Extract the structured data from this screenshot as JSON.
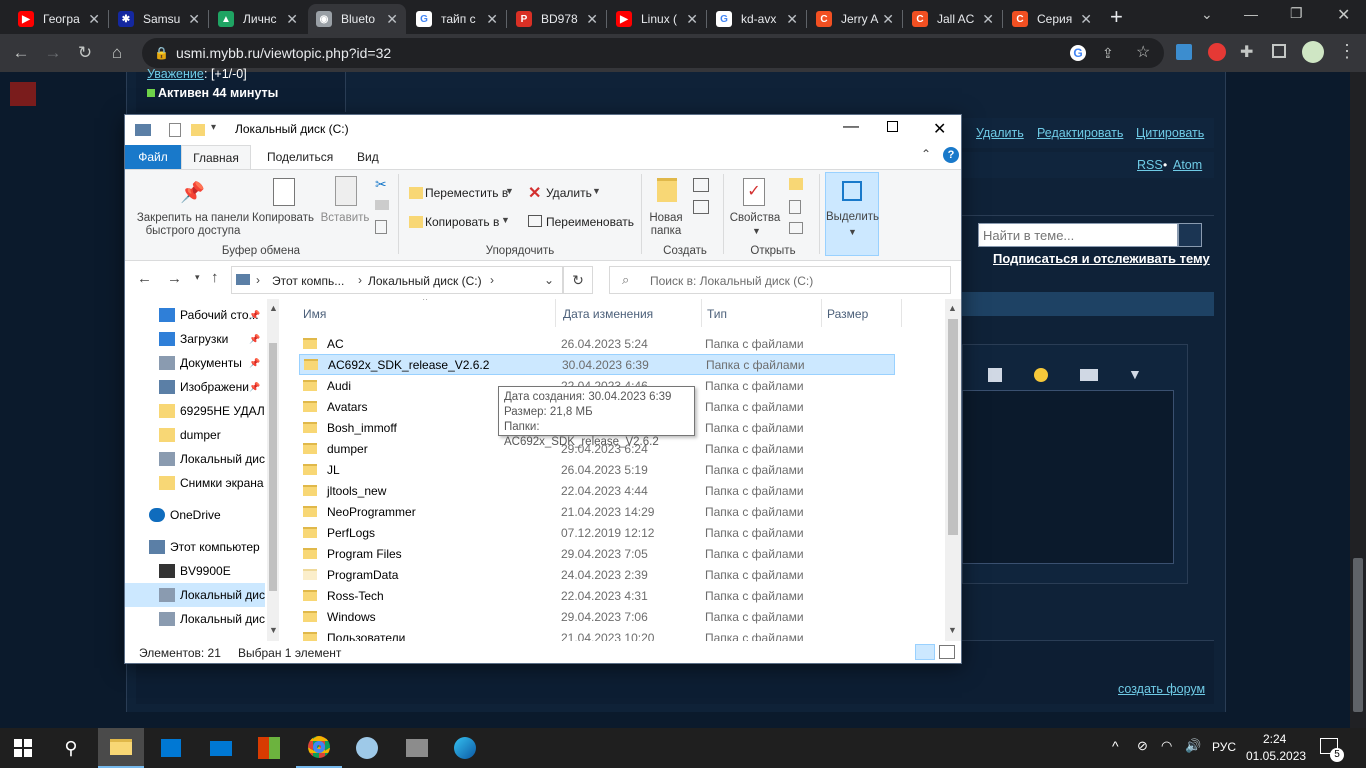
{
  "browser": {
    "tabs": [
      {
        "label": "Геогра",
        "color": "#ff0000",
        "glyph": "▶"
      },
      {
        "label": "Samsu",
        "color": "#1428a0",
        "glyph": "✱"
      },
      {
        "label": "Личнс",
        "color": "#1fa463",
        "glyph": "▲"
      },
      {
        "label": "Blueto",
        "color": "#9aa0a6",
        "glyph": "◉",
        "active": true
      },
      {
        "label": "тайп с",
        "color": "#ffffff",
        "glyph": "G"
      },
      {
        "label": "BD978",
        "color": "#d93025",
        "glyph": "P"
      },
      {
        "label": "Linux (",
        "color": "#ff0000",
        "glyph": "▶"
      },
      {
        "label": "kd-avx",
        "color": "#ffffff",
        "glyph": "G"
      },
      {
        "label": "Jerry A",
        "color": "#f25022",
        "glyph": "C"
      },
      {
        "label": "Jall AC",
        "color": "#f25022",
        "glyph": "C"
      },
      {
        "label": "Серия",
        "color": "#f25022",
        "glyph": "C"
      }
    ],
    "url": "usmi.mybb.ru/viewtopic.php?id=32"
  },
  "forum": {
    "respect": "Уважение",
    "respect_value": ": [+1/-0]",
    "active": "Активен 44 минуты",
    "delete": "Удалить",
    "edit": "Редактировать",
    "quote": "Цитировать",
    "rss": "RSS",
    "bullet": "•",
    "atom": "Atom",
    "search_placeholder": "Найти в теме...",
    "subscribe": "Подписаться и отслеживать тему",
    "create_forum": "создать форум"
  },
  "explorer": {
    "title": "Локальный диск (C:)",
    "ribbon_tabs": [
      "Файл",
      "Главная",
      "Поделиться",
      "Вид"
    ],
    "ribbon": {
      "pin": "Закрепить на панели быстрого доступа",
      "copy": "Копировать",
      "paste": "Вставить",
      "clipboard_group": "Буфер обмена",
      "move_to": "Переместить в",
      "copy_to": "Копировать в",
      "delete": "Удалить",
      "rename": "Переименовать",
      "organize_group": "Упорядочить",
      "new_folder": "Новая папка",
      "create_group": "Создать",
      "properties": "Свойства",
      "open_group": "Открыть",
      "select": "Выделить"
    },
    "breadcrumb": [
      "Этот компь...",
      "Локальный диск (C:)"
    ],
    "search_placeholder": "Поиск в: Локальный диск (C:)",
    "nav": [
      {
        "label": "Рабочий сто...",
        "icon": "desktop"
      },
      {
        "label": "Загрузки",
        "icon": "download"
      },
      {
        "label": "Документы",
        "icon": "documents"
      },
      {
        "label": "Изображени",
        "icon": "pictures"
      },
      {
        "label": "69295НЕ УДАЛЯ",
        "icon": "folder"
      },
      {
        "label": "dumper",
        "icon": "folder"
      },
      {
        "label": "Локальный дис",
        "icon": "drive"
      },
      {
        "label": "Снимки экрана",
        "icon": "folder"
      },
      {
        "label": "OneDrive",
        "icon": "cloud"
      },
      {
        "label": "Этот компьютер",
        "icon": "computer"
      },
      {
        "label": "BV9900E",
        "icon": "phone"
      },
      {
        "label": "Локальный дис",
        "icon": "drive",
        "selected": true
      },
      {
        "label": "Локальный дис",
        "icon": "drive"
      }
    ],
    "columns": [
      "Имя",
      "Дата изменения",
      "Тип",
      "Размер"
    ],
    "files": [
      {
        "name": "AC",
        "date": "26.04.2023 5:24",
        "type": "Папка с файлами"
      },
      {
        "name": "AC692x_SDK_release_V2.6.2",
        "date": "30.04.2023 6:39",
        "type": "Папка с файлами",
        "selected": true
      },
      {
        "name": "Audi",
        "date": "22.04.2023 4:46",
        "type": "Папка с файлами"
      },
      {
        "name": "Avatars",
        "date": "",
        "type": "Папка с файлами"
      },
      {
        "name": "Bosh_immoff",
        "date": "",
        "type": "Папка с файлами"
      },
      {
        "name": "dumper",
        "date": "29.04.2023 6:24",
        "type": "Папка с файлами"
      },
      {
        "name": "JL",
        "date": "26.04.2023 5:19",
        "type": "Папка с файлами"
      },
      {
        "name": "jltools_new",
        "date": "22.04.2023 4:44",
        "type": "Папка с файлами"
      },
      {
        "name": "NeoProgrammer",
        "date": "21.04.2023 14:29",
        "type": "Папка с файлами"
      },
      {
        "name": "PerfLogs",
        "date": "07.12.2019 12:12",
        "type": "Папка с файлами"
      },
      {
        "name": "Program Files",
        "date": "29.04.2023 7:05",
        "type": "Папка с файлами"
      },
      {
        "name": "ProgramData",
        "date": "24.04.2023 2:39",
        "type": "Папка с файлами"
      },
      {
        "name": "Ross-Tech",
        "date": "22.04.2023 4:31",
        "type": "Папка с файлами"
      },
      {
        "name": "Windows",
        "date": "29.04.2023 7:06",
        "type": "Папка с файлами"
      },
      {
        "name": "Пользователи",
        "date": "21.04.2023 10:20",
        "type": "Папка с файлами"
      }
    ],
    "tooltip": {
      "created": "Дата создания: 30.04.2023 6:39",
      "size": "Размер: 21,8 МБ",
      "folders": "Папки: AC692x_SDK_release_V2.6.2"
    },
    "status_count": "Элементов: 21",
    "status_selected": "Выбран 1 элемент"
  },
  "taskbar": {
    "language": "РУС",
    "time": "2:24",
    "date": "01.05.2023",
    "notifications": "5"
  }
}
